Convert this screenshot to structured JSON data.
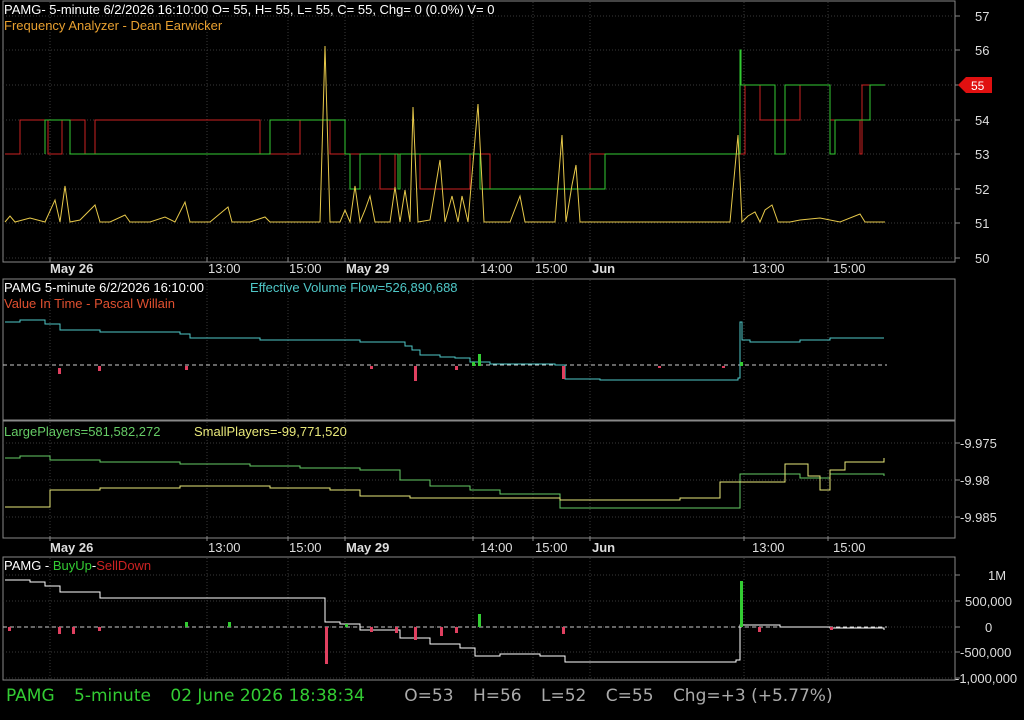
{
  "colors": {
    "background": "#000000",
    "grid": "#3a3a3a",
    "border": "#888888",
    "text": "#dddddd",
    "yellow": "#e6c84a",
    "orange": "#e8a030",
    "green": "#33cc33",
    "red": "#cc2222",
    "cyan": "#4fc8c8",
    "light_green": "#66cc66",
    "light_yellow": "#e8e87a",
    "white": "#ffffff",
    "status_green": "#33cc33",
    "status_grey": "#aaaaaa"
  },
  "panel1": {
    "header": "PAMG- 5-minute 6/2/2026 16:10:00 O= 55, H= 55, L= 55, C= 55, Chg= 0 (0.0%) V= 0",
    "indicator": "Frequency Analyzer - Dean Earwicker",
    "y_ticks": [
      "57",
      "56",
      "55",
      "54",
      "53",
      "52",
      "51",
      "50"
    ],
    "price_badge": "55"
  },
  "panel2": {
    "header": "PAMG 5-minute  6/2/2026 16:10:00",
    "flow_label": "Effective Volume Flow=526,890,688",
    "indicator": "Value In Time - Pascal Willain"
  },
  "panel3": {
    "large_label": "LargePlayers=581,582,272",
    "small_label": "SmallPlayers=-99,771,520",
    "y_ticks": [
      "-9.975",
      "-9.98",
      "-9.985"
    ]
  },
  "panel4": {
    "prefix": "PAMG - ",
    "buy_label": "BuyUp",
    "dash": "-",
    "sell_label": "SellDown",
    "y_ticks": [
      "1M",
      "500,000",
      "0",
      "-500,000",
      "-1,000,000"
    ]
  },
  "time_axis": {
    "labels": [
      "May 26",
      "13:00",
      "15:00",
      "May 29",
      "14:00",
      "15:00",
      "Jun",
      "13:00",
      "15:00"
    ],
    "bold": [
      true,
      false,
      false,
      true,
      false,
      false,
      true,
      false,
      false
    ]
  },
  "status_bar": {
    "symbol": "PAMG",
    "interval": "5-minute",
    "datetime": "02 June 2026 18:38:34",
    "open": "O=53",
    "high": "H=56",
    "low": "L=52",
    "close": "C=55",
    "change": "Chg=+3 (+5.77%)"
  }
}
